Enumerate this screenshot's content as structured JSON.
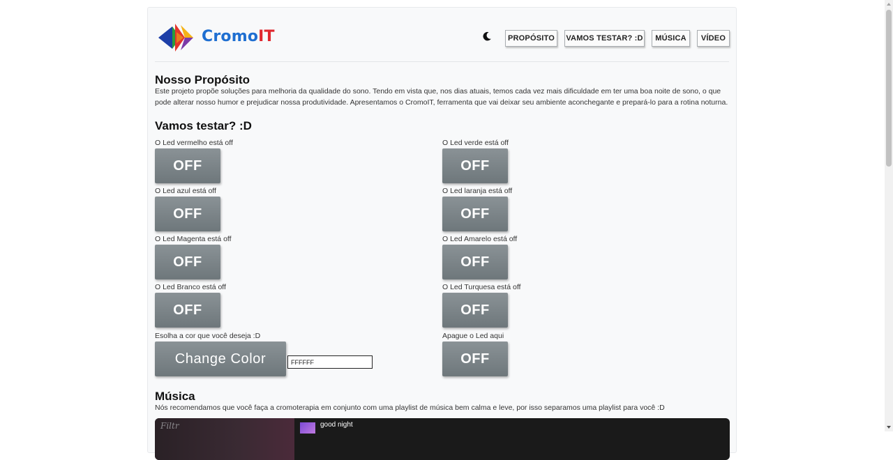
{
  "brand": {
    "part1": "Cromo",
    "part2": "IT"
  },
  "nav": {
    "proposito": "PROPÓSITO",
    "testar": "VAMOS TESTAR? :D",
    "musica": "MÚSICA",
    "video": "VÍDEO"
  },
  "purpose": {
    "title": "Nosso Propósito",
    "text": "Este projeto propõe soluções para melhoria da qualidade do sono. Tendo em vista que, nos dias atuais, temos cada vez mais dificuldade em ter uma boa noite de sono, o que pode alterar nosso humor e prejudicar nossa produtividade. Apresentamos o CromoIT, ferramenta que vai deixar seu ambiente aconchegante e prepará-lo para a rotina noturna."
  },
  "test": {
    "title": "Vamos testar? :D",
    "leds": [
      {
        "label": "O Led vermelho está off",
        "button": "OFF"
      },
      {
        "label": "O Led verde está off",
        "button": "OFF"
      },
      {
        "label": "O Led azul está off",
        "button": "OFF"
      },
      {
        "label": "O Led laranja está off",
        "button": "OFF"
      },
      {
        "label": "O Led Magenta está off",
        "button": "OFF"
      },
      {
        "label": "O Led Amarelo está off",
        "button": "OFF"
      },
      {
        "label": "O Led Branco está off",
        "button": "OFF"
      },
      {
        "label": "O Led Turquesa está off",
        "button": "OFF"
      }
    ],
    "color": {
      "label": "Esolha a cor que você deseja :D",
      "button": "Change Color",
      "value": "FFFFFF"
    },
    "off": {
      "label": "Apague o Led aqui",
      "button": "OFF"
    }
  },
  "music": {
    "title": "Música",
    "text": "Nós recomendamos que você faça a cromoterapia em conjunto com uma playlist de música bem calma e leve, por isso separamos uma playlist para você :D",
    "player": {
      "cover_text": "Filtr",
      "song": "good night"
    }
  },
  "icons": {
    "theme": "moon-icon"
  }
}
